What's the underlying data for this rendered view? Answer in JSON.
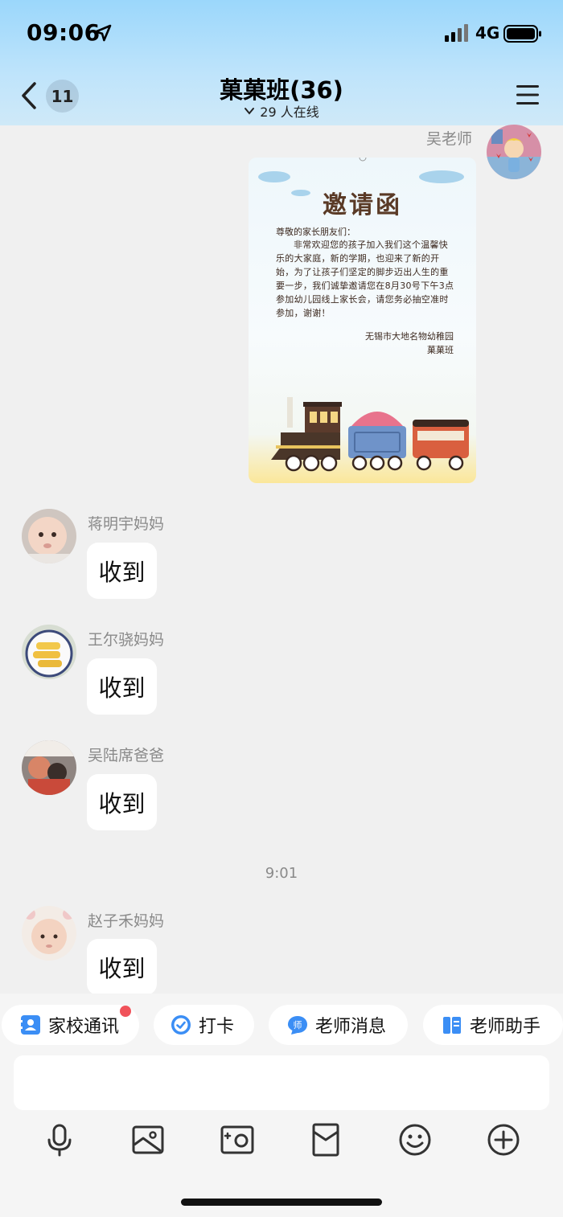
{
  "status_bar": {
    "time": "09:06",
    "network": "4G"
  },
  "header": {
    "unread_count": "11",
    "title": "菓菓班(36)",
    "online": "29 人在线"
  },
  "messages": [
    {
      "sender": "吴老师",
      "type": "image",
      "side": "right"
    },
    {
      "sender": "蒋明宇妈妈",
      "text": "收到",
      "side": "left"
    },
    {
      "sender": "王尔骁妈妈",
      "text": "收到",
      "side": "left"
    },
    {
      "sender": "吴陆席爸爸",
      "text": "收到",
      "side": "left"
    },
    {
      "sender": "赵子禾妈妈",
      "text": "收到",
      "side": "left"
    }
  ],
  "time_separator": "9:01",
  "invitation": {
    "title": "邀请函",
    "greeting": "尊敬的家长朋友们：",
    "body": "非常欢迎您的孩子加入我们这个温馨快乐的大家庭，新的学期，也迎来了新的开始，为了让孩子们坚定的脚步迈出人生的重要一步，我们诚挚邀请您在8月30号下午3点参加幼儿园线上家长会，请您务必抽空准时参加，谢谢！",
    "signature_school": "无锡市大地名物幼稚园",
    "signature_class": "菓菓班"
  },
  "quick_actions": [
    {
      "label": "家校通讯",
      "icon": "contacts-icon",
      "badge": true
    },
    {
      "label": "打卡",
      "icon": "check-circle-icon",
      "badge": false
    },
    {
      "label": "老师消息",
      "icon": "teacher-message-icon",
      "badge": false
    },
    {
      "label": "老师助手",
      "icon": "book-icon",
      "badge": false
    }
  ],
  "input": {
    "placeholder": ""
  },
  "toolbar": [
    "microphone-icon",
    "image-icon",
    "camera-icon",
    "red-envelope-icon",
    "emoji-icon",
    "plus-icon"
  ],
  "colors": {
    "header_top": "#9bd7fb",
    "chat_bg": "#f0f0f0",
    "badge_red": "#f0525a",
    "accent_blue": "#3b8ef5"
  }
}
